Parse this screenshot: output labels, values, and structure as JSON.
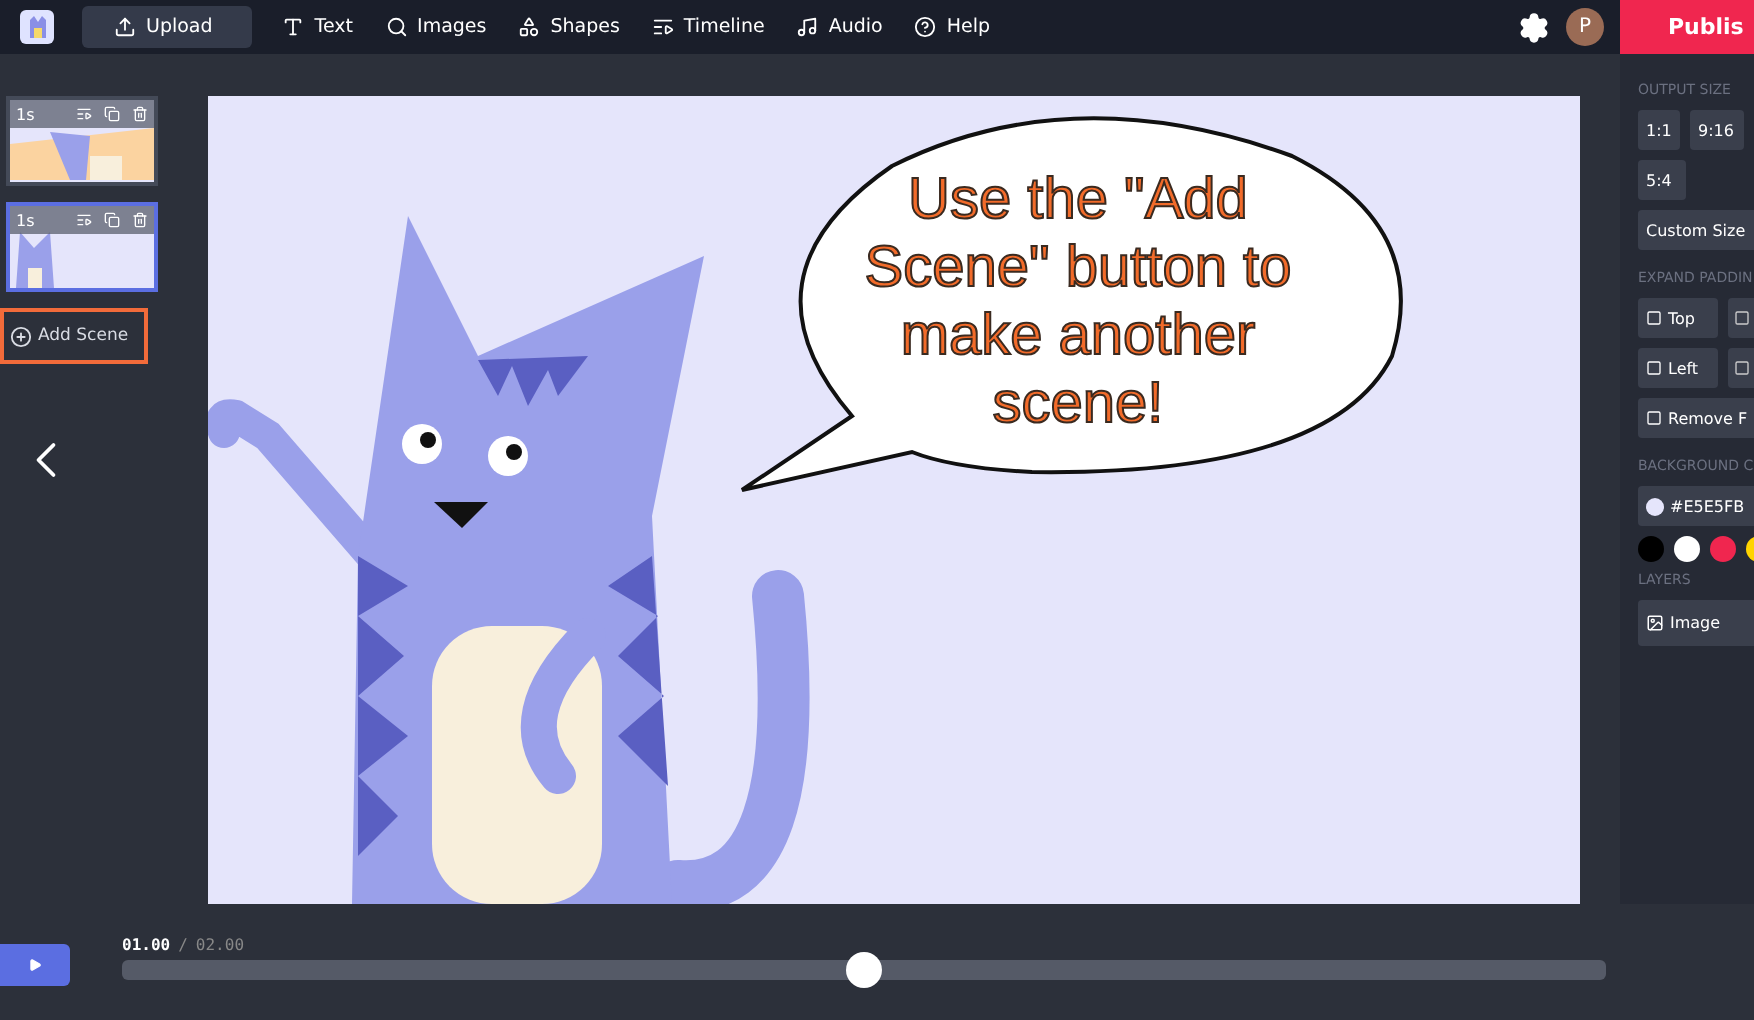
{
  "toolbar": {
    "items": [
      {
        "label": "Upload",
        "kind": "upload",
        "selected": true
      },
      {
        "label": "Text",
        "kind": "text",
        "selected": false
      },
      {
        "label": "Images",
        "kind": "search",
        "selected": false
      },
      {
        "label": "Shapes",
        "kind": "shapes",
        "selected": false
      },
      {
        "label": "Timeline",
        "kind": "timeline",
        "selected": false
      },
      {
        "label": "Audio",
        "kind": "audio",
        "selected": false
      },
      {
        "label": "Help",
        "kind": "help",
        "selected": false
      }
    ],
    "avatar": "P",
    "publish_button": "Publis"
  },
  "scenes": [
    {
      "duration": "1s",
      "selected": false,
      "kind": "desk"
    },
    {
      "duration": "1s",
      "selected": true,
      "kind": "plain"
    }
  ],
  "add_scene_button": "Add Scene",
  "speech_bubble": "Use the \"Add Scene\" button to make another scene!",
  "right_panel": {
    "output_size": {
      "title": "OUTPUT SIZE",
      "options": [
        "1:1",
        "9:16",
        "5:4"
      ],
      "custom": "Custom Size"
    },
    "expand_padding": {
      "title": "EXPAND PADDIN",
      "options": [
        {
          "label": "Top",
          "checked": false
        },
        {
          "label": "Left",
          "checked": false
        },
        {
          "label": "Remove F",
          "checked": false
        }
      ]
    },
    "background_color": {
      "title": "BACKGROUND C",
      "value": "#E5E5FB",
      "swatches": [
        {
          "color": "#000000"
        },
        {
          "color": "#ffffff"
        },
        {
          "color": "#f0264f"
        },
        {
          "color": "#ffd400"
        }
      ]
    },
    "layers": {
      "title": "LAYERS",
      "items": [
        "Image"
      ]
    }
  },
  "timeline": {
    "current": "01.00",
    "separator": "/",
    "total": "02.00",
    "level": 0.5
  }
}
